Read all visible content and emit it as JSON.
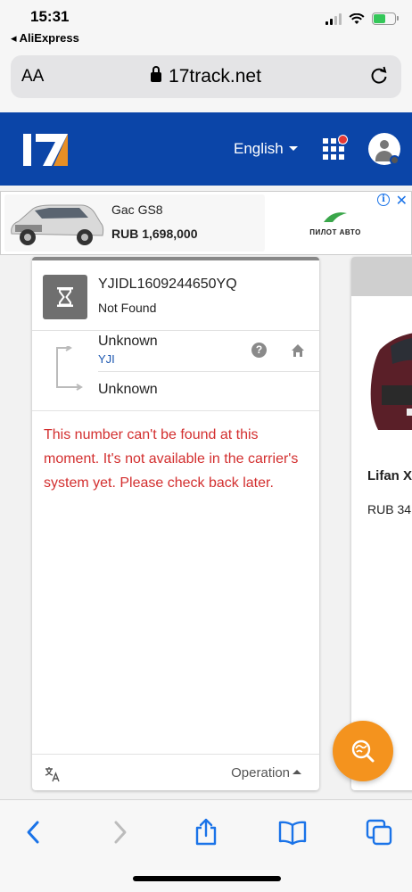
{
  "status_bar": {
    "time": "15:31",
    "back_app": "AliExpress"
  },
  "browser": {
    "text_size_label": "AA",
    "url": "17track.net"
  },
  "site_header": {
    "logo_text": "17",
    "language": "English"
  },
  "ad": {
    "title": "Gac GS8",
    "price": "RUB 1,698,000",
    "brand": "ПИЛОТ АВТО",
    "info_symbol": "i",
    "close_symbol": "✕"
  },
  "tracking": {
    "number": "YJIDL1609244650YQ",
    "status": "Not Found",
    "origin": "Unknown",
    "carrier": "YJI",
    "destination": "Unknown",
    "message": "This number can't be found at this moment. It's not available in the carrier's system yet. Please check back later.",
    "operation_label": "Operation",
    "help_symbol": "?"
  },
  "side_ad": {
    "name": "Lifan X",
    "price": "RUB 34"
  },
  "colors": {
    "header_blue": "#0b45a8",
    "fab_orange": "#f4931e",
    "error_red": "#d32f2f",
    "ios_blue": "#1a73e8"
  }
}
